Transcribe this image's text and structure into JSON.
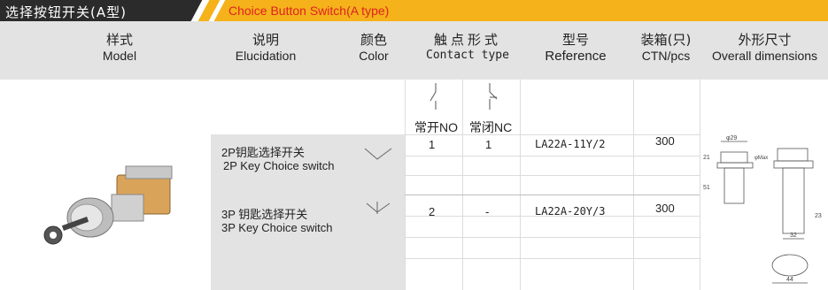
{
  "banner": {
    "title_cn": "选择按钮开关(A型)",
    "title_en": "Choice Button Switch(A type)"
  },
  "header": {
    "model": {
      "cn": "样式",
      "en": "Model"
    },
    "elucidation": {
      "cn": "说明",
      "en": "Elucidation"
    },
    "color": {
      "cn": "颜色",
      "en": "Color"
    },
    "contact": {
      "cn": "触点形式",
      "en": "Contact type"
    },
    "reference": {
      "cn": "型号",
      "en": "Reference"
    },
    "ctn": {
      "cn": "装箱(只)",
      "en": "CTN/pcs"
    },
    "dimensions": {
      "cn": "外形尺寸",
      "en": "Overall dimensions"
    }
  },
  "contact_labels": {
    "no": "常开NO",
    "nc": "常闭NC"
  },
  "rows": [
    {
      "desc_cn": "2P钥匙选择开关",
      "desc_en": "2P Key Choice switch",
      "no": "1",
      "nc": "1",
      "reference": "LA22A-11Y/2",
      "ctn": "300"
    },
    {
      "desc_cn": "3P 钥匙选择开关",
      "desc_en": "3P Key Choice switch",
      "no": "2",
      "nc": "-",
      "reference": "LA22A-20Y/3",
      "ctn": "300"
    }
  ],
  "dims": {
    "d1": "φ29",
    "d2": "21",
    "d3": "φMax",
    "d4": "51",
    "d5": "23",
    "d6": "32",
    "d7": "44"
  },
  "colors": {
    "band_dark": "#2b2b2b",
    "band_orange": "#f5b21a",
    "title_red": "#d22222",
    "header_gray": "#e3e3e3"
  }
}
